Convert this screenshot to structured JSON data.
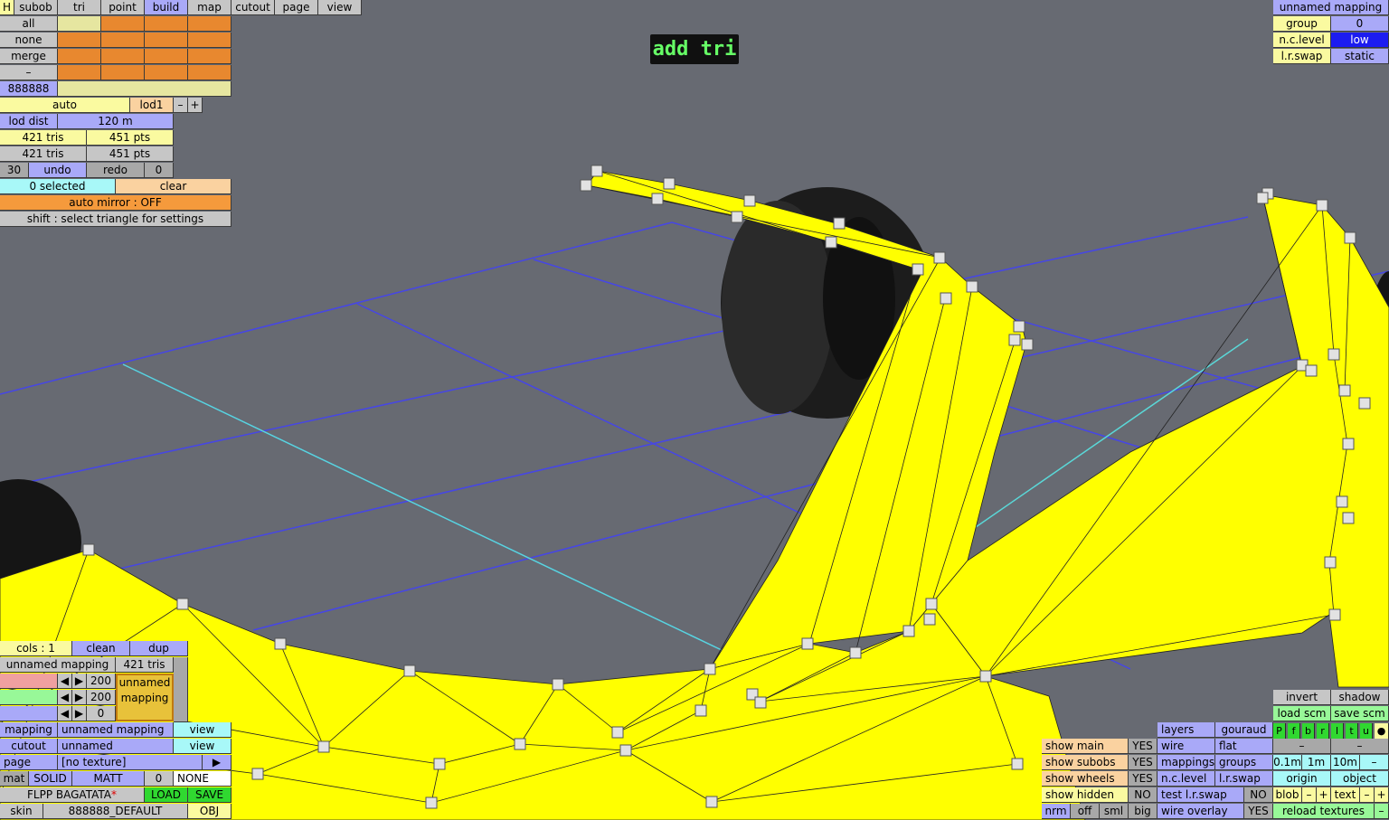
{
  "banner": "add tri",
  "top_tabs": [
    "H",
    "subob",
    "tri",
    "point",
    "build",
    "map",
    "cutout",
    "page",
    "view"
  ],
  "subob_panel": {
    "rows": [
      "all",
      "none",
      "merge",
      "–"
    ],
    "code": "888888",
    "lod_mode": "auto",
    "lod_name": "lod1",
    "lod_minus": "–",
    "lod_plus": "+",
    "lod_dist_label": "lod dist",
    "lod_dist_value": "120 m",
    "stats_tris_1": "421 tris",
    "stats_pts_1": "451 pts",
    "stats_tris_2": "421 tris",
    "stats_pts_2": "451 pts",
    "undo_count": "30",
    "undo": "undo",
    "redo": "redo",
    "redo_count": "0",
    "selected": "0 selected",
    "clear": "clear",
    "auto_mirror": "auto mirror : OFF",
    "hint": "shift : select triangle for settings"
  },
  "mapping_panel": {
    "title": "unnamed mapping",
    "group_label": "group",
    "group_value": "0",
    "nclevel_label": "n.c.level",
    "nclevel_value": "low",
    "lrswap_label": "l.r.swap",
    "lrswap_value": "static"
  },
  "bottom_left": {
    "cols": "cols : 1",
    "clean": "clean",
    "dup": "dup",
    "mapping_name": "unnamed mapping",
    "mapping_tris": "421 tris",
    "val_1": "200",
    "val_2": "200",
    "val_3": "0",
    "preview_label": "unnamed mapping",
    "mapping_label": "mapping",
    "mapping_value": "unnamed mapping",
    "mapping_view": "view",
    "cutout_label": "cutout",
    "cutout_value": "unnamed",
    "cutout_view": "view",
    "page_label": "page",
    "page_value": "[no texture]",
    "page_arrow": "▶",
    "mat_label": "mat",
    "mat_solid": "SOLID",
    "mat_matt": "MATT",
    "mat_num": "0",
    "mat_none": "NONE",
    "car_name": "FLPP BAGATATA",
    "car_star": "*",
    "load": "LOAD",
    "save": "SAVE",
    "skin_label": "skin",
    "skin_value": "888888_DEFAULT",
    "obj": "OBJ"
  },
  "show_panel": {
    "show_main": "show main",
    "show_main_v": "YES",
    "show_subobs": "show subobs",
    "show_subobs_v": "YES",
    "show_wheels": "show wheels",
    "show_wheels_v": "YES",
    "show_hidden": "show hidden",
    "show_hidden_v": "NO",
    "nrm": "nrm",
    "off": "off",
    "sml": "sml",
    "big": "big"
  },
  "view_panel": {
    "layers": "layers",
    "gouraud": "gouraud",
    "wire": "wire",
    "flat": "flat",
    "mappings": "mappings",
    "groups": "groups",
    "nclevel": "n.c.level",
    "lrswap": "l.r.swap",
    "test_lrswap": "test l.r.swap",
    "test_lrswap_v": "NO",
    "wire_overlay": "wire overlay",
    "wire_overlay_v": "YES"
  },
  "right_panel": {
    "invert": "invert",
    "shadow": "shadow",
    "load_scm": "load scm",
    "save_scm": "save scm",
    "toggles": [
      "P",
      "f",
      "b",
      "r",
      "l",
      "t",
      "u",
      "●"
    ],
    "dash1": "–",
    "dash2": "–",
    "s01": "0.1m",
    "s1": "1m",
    "s10": "10m",
    "sdash": "–",
    "origin": "origin",
    "object": "object",
    "blob": "blob",
    "blob_minus": "–",
    "blob_plus": "+",
    "text": "text",
    "text_minus": "–",
    "text_plus": "+",
    "reload": "reload textures",
    "reload_dash": "–"
  },
  "colors": {
    "model": "#ffff00",
    "background": "#676a72",
    "grid": "#4444ee",
    "axis": "#55dddd",
    "vertex": "#e0e0e0"
  }
}
